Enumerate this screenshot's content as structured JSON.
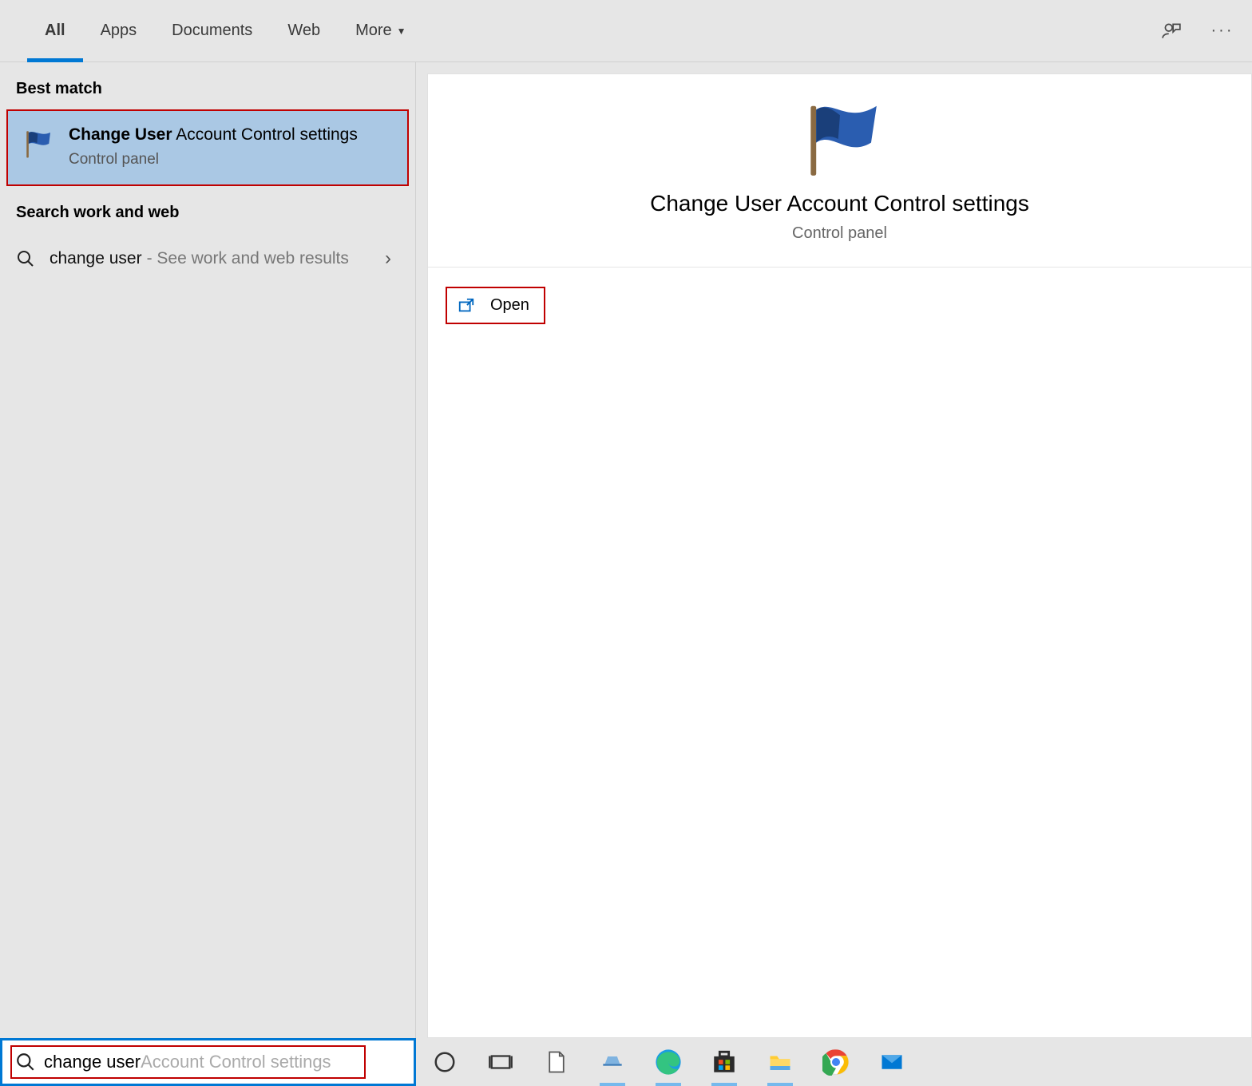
{
  "tabs": {
    "items": [
      {
        "label": "All",
        "active": true
      },
      {
        "label": "Apps"
      },
      {
        "label": "Documents"
      },
      {
        "label": "Web"
      },
      {
        "label": "More"
      }
    ]
  },
  "sections": {
    "best_match_header": "Best match",
    "search_web_header": "Search work and web"
  },
  "best_match": {
    "title_bold": "Change User",
    "title_rest": " Account Control settings",
    "subtitle": "Control panel"
  },
  "search_web_row": {
    "query": "change user",
    "hint": "- See work and web results"
  },
  "detail": {
    "title": "Change User Account Control settings",
    "subtitle": "Control panel",
    "open_label": "Open"
  },
  "searchbox": {
    "typed": "change user ",
    "completion": "Account Control settings"
  }
}
